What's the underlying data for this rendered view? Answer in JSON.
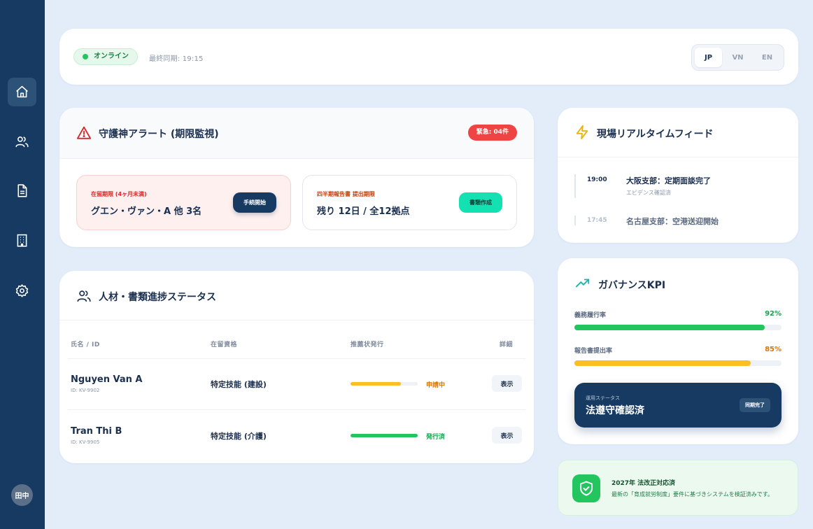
{
  "sidebar": {
    "items": [
      {
        "icon": "home-icon"
      },
      {
        "icon": "users-icon"
      },
      {
        "icon": "document-icon"
      },
      {
        "icon": "building-icon"
      },
      {
        "icon": "gear-icon"
      }
    ],
    "avatar": "田中"
  },
  "topbar": {
    "status": "オンライン",
    "sync": "最終同期: 19:15",
    "languages": [
      "JP",
      "VN",
      "EN"
    ],
    "active_language": "JP"
  },
  "alerts": {
    "title": "守護神アラート (期限監視)",
    "badge": "緊急: 04件",
    "items": [
      {
        "sub": "在留期限 (4ヶ月未満)",
        "main": "グエン・ヴァン・A 他 3名",
        "button": "手続開始",
        "sub_color": "#dc2626"
      },
      {
        "sub": "四半期報告書 提出期限",
        "main": "残り 12日 / 全12拠点",
        "button": "書類作成",
        "sub_color": "#c2410c"
      }
    ]
  },
  "progress_table": {
    "title": "人材・書類進捗ステータス",
    "columns": [
      "氏名 / ID",
      "在留資格",
      "推薦状発行",
      "詳細"
    ],
    "rows": [
      {
        "name": "Nguyen Van A",
        "id": "ID: KV-9902",
        "visa": "特定技能 (建設)",
        "progress": 0.75,
        "bar_color": "#fbbf24",
        "status": "申請中",
        "status_color": "#d97706",
        "action": "表示"
      },
      {
        "name": "Tran Thi B",
        "id": "ID: KV-9905",
        "visa": "特定技能 (介護)",
        "progress": 1.0,
        "bar_color": "#22c55e",
        "status": "発行済",
        "status_color": "#16a34a",
        "action": "表示"
      }
    ]
  },
  "feed": {
    "title": "現場リアルタイムフィード",
    "items": [
      {
        "time": "19:00",
        "text": "大阪支部：定期面談完了",
        "sub": "エビデンス確認済"
      },
      {
        "time": "17:45",
        "text": "名古屋支部：空港送迎開始",
        "sub": ""
      }
    ]
  },
  "kpi": {
    "title": "ガバナンスKPI",
    "metrics": [
      {
        "label": "義務履行率",
        "value": "92%",
        "fraction": 0.92,
        "color": "#22c55e",
        "value_color": "#16a34a"
      },
      {
        "label": "報告書提出率",
        "value": "85%",
        "fraction": 0.85,
        "color": "#fbbf24",
        "value_color": "#d97706"
      }
    ],
    "ops_sub": "運用ステータス",
    "ops_main": "法遵守確認済",
    "ops_badge": "同期完了"
  },
  "compliance": {
    "title": "2027年 法改正対応済",
    "desc": "最新の「育成就労制度」要件に基づきシステムを検証済みです。"
  },
  "colors": {
    "navy": "#163a62",
    "background": "#e3edfa",
    "danger": "#ef4444",
    "success": "#22c55e",
    "warning": "#fbbf24",
    "teal": "#14e1b2"
  }
}
